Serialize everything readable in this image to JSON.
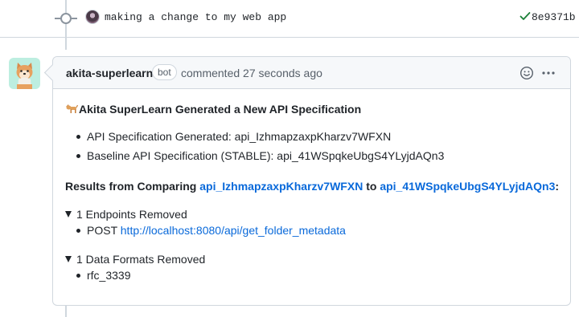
{
  "commit": {
    "message": "making a change to my web app",
    "sha": "8e9371b"
  },
  "comment": {
    "author": "akita-superlearn",
    "badge": "bot",
    "meta": "commented 27 seconds ago",
    "title": "Akita SuperLearn Generated a New API Specification",
    "spec_items": [
      "API Specification Generated: api_IzhmapzaxpKharzv7WFXN",
      "Baseline API Specification (STABLE): api_41WSpqkeUbgS4YLyjdAQn3"
    ],
    "results": {
      "prefix": "Results from Comparing ",
      "link_a": "api_IzhmapzaxpKharzv7WFXN",
      "middle": " to ",
      "link_b": "api_41WSpqkeUbgS4YLyjdAQn3",
      "suffix": ":"
    },
    "endpoints": {
      "summary": "1 Endpoints Removed",
      "method": "POST ",
      "url": "http://localhost:8080/api/get_folder_metadata"
    },
    "formats": {
      "summary": "1 Data Formats Removed",
      "item": "rfc_3339"
    }
  },
  "colors": {
    "link": "#0969da",
    "success": "#1a7f37",
    "bot_avatar_bg": "#bdeee0"
  }
}
